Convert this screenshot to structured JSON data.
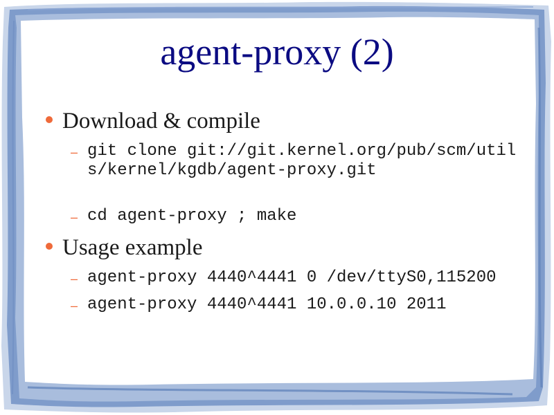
{
  "slide": {
    "title": "agent-proxy (2)",
    "accent_color": "#ef6a3a",
    "title_color": "#0b0b82",
    "frame_color": "#5b7fb8",
    "bullets": [
      {
        "text": "Download & compile",
        "subitems": [
          "git clone git://git.kernel.org/pub/scm/utils/kernel/kgdb/agent-proxy.git",
          "cd agent-proxy ; make"
        ]
      },
      {
        "text": "Usage example",
        "subitems": [
          "agent-proxy 4440^4441 0 /dev/ttyS0,115200",
          "agent-proxy 4440^4441 10.0.0.10 2011"
        ]
      }
    ]
  },
  "icons": {
    "bullet": "bullet-dot-icon",
    "sub_bullet": "dash-icon"
  }
}
